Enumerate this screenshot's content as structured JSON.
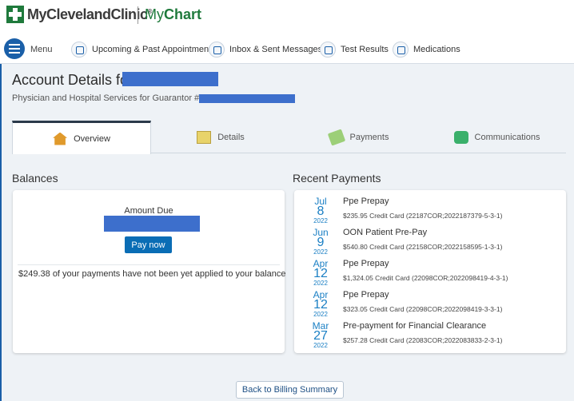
{
  "header": {
    "brand": "MyClevelandClinic",
    "brand_mark": "®",
    "product_prefix": "My",
    "product_suffix": "Chart"
  },
  "nav": {
    "menu_label": "Menu",
    "items": [
      {
        "label": "Upcoming & Past Appointments",
        "icon": "calendar-icon"
      },
      {
        "label": "Inbox & Sent Messages",
        "icon": "envelope-icon"
      },
      {
        "label": "Test Results",
        "icon": "flask-icon"
      },
      {
        "label": "Medications",
        "icon": "pill-icon"
      }
    ]
  },
  "page": {
    "title": "Account Details for",
    "subtitle": "Physician and Hospital Services for Guarantor #3"
  },
  "tabs": [
    {
      "label": "Overview",
      "icon": "house-icon",
      "active": true
    },
    {
      "label": "Details",
      "icon": "document-icon",
      "active": false
    },
    {
      "label": "Payments",
      "icon": "money-icon",
      "active": false
    },
    {
      "label": "Communications",
      "icon": "chat-icon",
      "active": false
    }
  ],
  "balances": {
    "title": "Balances",
    "amount_due_label": "Amount Due",
    "pay_now_label": "Pay now",
    "unapplied_note": "$249.38 of your payments have not been yet applied to your balance"
  },
  "recent_payments": {
    "title": "Recent Payments",
    "items": [
      {
        "month": "Jul",
        "day": "8",
        "year": "2022",
        "title": "Ppe Prepay",
        "detail": "$235.95 Credit Card (22187COR;2022187379-5-3-1)"
      },
      {
        "month": "Jun",
        "day": "9",
        "year": "2022",
        "title": "OON Patient Pre-Pay",
        "detail": "$540.80 Credit Card (22158COR;2022158595-1-3-1)"
      },
      {
        "month": "Apr",
        "day": "12",
        "year": "2022",
        "title": "Ppe Prepay",
        "detail": "$1,324.05 Credit Card (22098COR;2022098419-4-3-1)"
      },
      {
        "month": "Apr",
        "day": "12",
        "year": "2022",
        "title": "Ppe Prepay",
        "detail": "$323.05 Credit Card (22098COR;2022098419-3-3-1)"
      },
      {
        "month": "Mar",
        "day": "27",
        "year": "2022",
        "title": "Pre-payment for Financial Clearance",
        "detail": "$257.28 Credit Card (22083COR;2022083833-2-3-1)"
      }
    ]
  },
  "footer": {
    "back_label": "Back to Billing Summary"
  },
  "colors": {
    "brand_green": "#1f7a3c",
    "accent_blue": "#0a6db5",
    "date_blue": "#1a7fc4",
    "redaction": "#3d6fcc"
  }
}
